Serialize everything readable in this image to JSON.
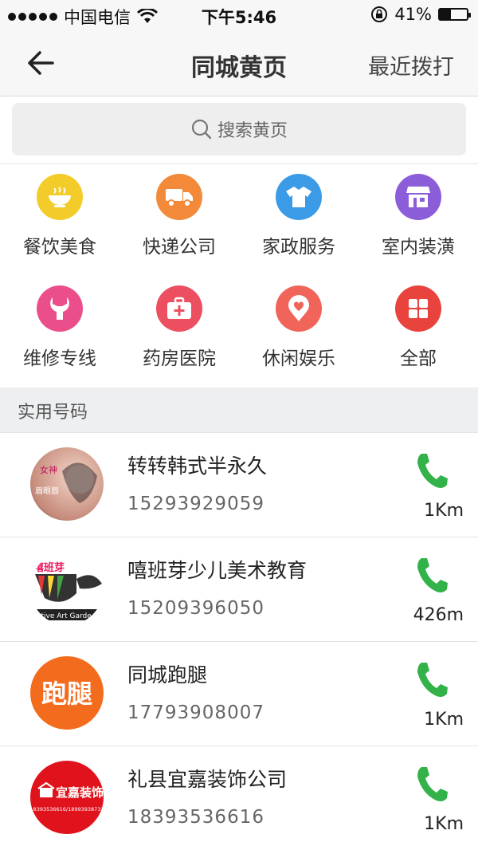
{
  "status_bar": {
    "carrier": "中国电信",
    "time": "下午5:46",
    "battery": "41%",
    "battery_level": 0.41
  },
  "nav": {
    "title": "同城黄页",
    "right_action": "最近拨打"
  },
  "search": {
    "placeholder": "搜索黄页"
  },
  "categories": [
    {
      "label": "餐饮美食",
      "icon": "bowl-icon",
      "color": "#f3cc2a"
    },
    {
      "label": "快递公司",
      "icon": "truck-icon",
      "color": "#f28a3a"
    },
    {
      "label": "家政服务",
      "icon": "shirt-icon",
      "color": "#3b9be6"
    },
    {
      "label": "室内装潢",
      "icon": "storefront-icon",
      "color": "#8b5dd8"
    },
    {
      "label": "维修专线",
      "icon": "wrench-icon",
      "color": "#ea4f8c"
    },
    {
      "label": "药房医院",
      "icon": "medkit-icon",
      "color": "#ec4f5f"
    },
    {
      "label": "休闲娱乐",
      "icon": "heart-pin-icon",
      "color": "#f0645a"
    },
    {
      "label": "全部",
      "icon": "grid-icon",
      "color": "#e8433c"
    }
  ],
  "section": {
    "title": "实用号码"
  },
  "listings": [
    {
      "name": "转转韩式半永久",
      "phone": "15293929059",
      "distance": "1Km",
      "logo_text": [
        "女神",
        "眉眼唇"
      ]
    },
    {
      "name": "嘻班芽少儿美术教育",
      "phone": "15209396050",
      "distance": "426m",
      "logo_text": [
        "嘻班芽",
        "ative Art Garde"
      ]
    },
    {
      "name": "同城跑腿",
      "phone": "17793908007",
      "distance": "1Km",
      "logo_text": [
        "跑腿"
      ]
    },
    {
      "name": "礼县宜嘉装饰公司",
      "phone": "18393536616",
      "distance": "1Km",
      "logo_text": [
        "宜嘉装饰",
        "18393536616/18993938732"
      ]
    }
  ],
  "colors": {
    "call_green": "#33b24a",
    "background": "#ffffff",
    "section_bg": "#eeeff1"
  }
}
